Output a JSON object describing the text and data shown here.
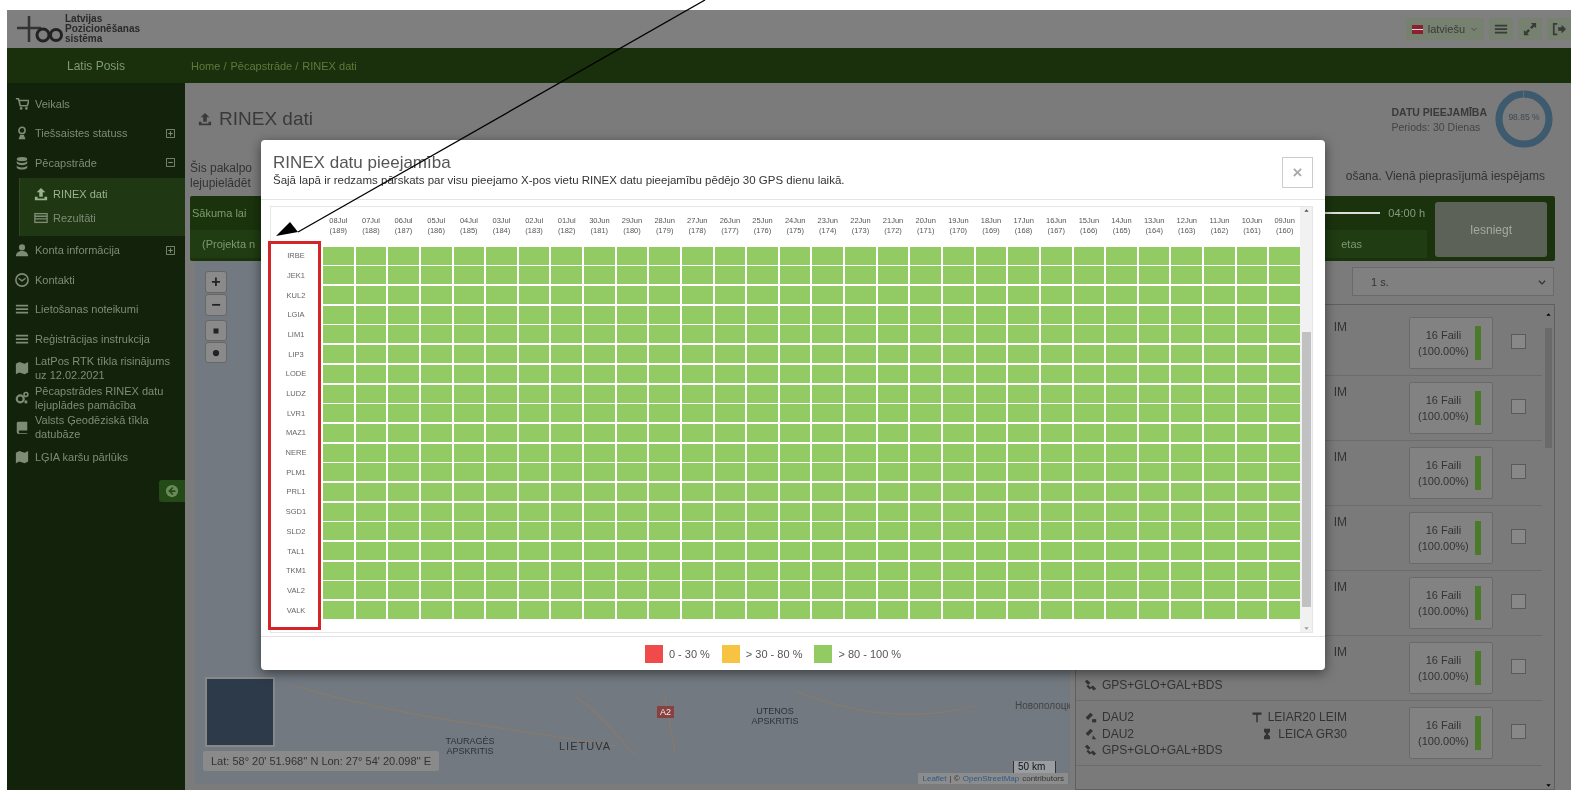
{
  "header": {
    "logo_text": [
      "Latvijas",
      "Pozicionēšanas",
      "sistēma"
    ],
    "language": "latviešu"
  },
  "nav": {
    "user": "Latis Posis",
    "breadcrumbs": [
      "Home /",
      "Pēcapstrāde /",
      "RINEX dati"
    ]
  },
  "sidebar": {
    "items": [
      {
        "label": "Veikals"
      },
      {
        "label": "Tiešsaistes statuss",
        "expanded": false
      },
      {
        "label": "Pēcapstrāde",
        "expanded": true,
        "children": [
          {
            "label": "RINEX dati",
            "selected": true
          },
          {
            "label": "Rezultāti",
            "selected": false
          }
        ]
      },
      {
        "label": "Konta informācija",
        "expanded": false
      },
      {
        "label": "Kontakti"
      },
      {
        "label": "Lietošanas noteikumi"
      },
      {
        "label": "Reģistrācijas instrukcija"
      },
      {
        "label": "LatPos RTK tīkla risinājums uz 12.02.2021"
      },
      {
        "label": "Pēcapstrādes RINEX datu lejuplādes pamācība"
      },
      {
        "label": "Valsts Ģeodēziskā tīkla datubāze"
      },
      {
        "label": "LĢIA karšu pārlūks"
      }
    ]
  },
  "page": {
    "title": "RINEX dati",
    "availability": {
      "label": "DATU PIEEJAMĪBA",
      "period": "Periods: 30 Dienas",
      "value": "98.85 %",
      "level": 0.9885
    },
    "description_left": [
      "Šis pakalpo",
      "lejupielādēt"
    ],
    "description_right": "ošana. Vienā pieprasījumā iespējams",
    "form": {
      "start_label": "Sākuma lai",
      "project_label": "(Projekta n",
      "slider": {
        "level": 1
      },
      "duration": "04:00 h",
      "tail_label": "etas",
      "submit": "Iesniegt"
    },
    "interval": "1 s.",
    "map": {
      "labels": [
        {
          "text": "TAURAGĖS APSKRITIS",
          "kind": "region"
        },
        {
          "text": "LIETUVA",
          "kind": "country"
        },
        {
          "text": "A2",
          "kind": "road"
        },
        {
          "text": "UTENOS APSKRITIS",
          "kind": "region"
        },
        {
          "text": "Новополоцк",
          "kind": "city"
        }
      ],
      "zoom_in": "+",
      "zoom_out": "−",
      "coordinates": "Lat: 58° 20' 51.968'' N Lon: 27° 54' 20.098'' E",
      "scale": "50 km",
      "attribution_link": "Leaflet",
      "attribution_sep": "| ©",
      "attribution_osm": "OpenStreetMap",
      "attribution_tail": "contributors"
    },
    "stations": [
      {
        "antenna": [
          "IM"
        ],
        "files": "16 Faili",
        "percent": "(100.00%)",
        "level": 1,
        "checked": false
      },
      {
        "antenna": [
          "IM"
        ],
        "files": "16 Faili",
        "percent": "(100.00%)",
        "level": 1,
        "checked": false
      },
      {
        "antenna": [
          "IM"
        ],
        "files": "16 Faili",
        "percent": "(100.00%)",
        "level": 1,
        "checked": false
      },
      {
        "antenna": [
          "IM"
        ],
        "files": "16 Faili",
        "percent": "(100.00%)",
        "level": 1,
        "checked": false
      },
      {
        "antenna": [
          "IM"
        ],
        "files": "16 Faili",
        "percent": "(100.00%)",
        "level": 1,
        "checked": false
      },
      {
        "antenna": [
          "IM"
        ],
        "constellation": "GPS+GLO+GAL+BDS",
        "files": "16 Faili",
        "percent": "(100.00%)",
        "level": 1,
        "checked": false
      },
      {
        "receiver": [
          "DAU2",
          "DAU2"
        ],
        "constellation": "GPS+GLO+GAL+BDS",
        "antenna": [
          "LEIAR20 LEIM",
          "LEICA GR30"
        ],
        "files": "16 Faili",
        "percent": "(100.00%)",
        "level": 1,
        "checked": false
      }
    ]
  },
  "modal": {
    "title": "RINEX datu pieejamība",
    "subtitle": "Šajā lapā ir redzams pārskats par visu pieejamo X-pos vietu RINEX datu pieejamību pēdējo 30 GPS dienu laikā.",
    "close": "×",
    "columns": [
      {
        "date": "08Jul",
        "day": "(189)"
      },
      {
        "date": "07Jul",
        "day": "(188)"
      },
      {
        "date": "06Jul",
        "day": "(187)"
      },
      {
        "date": "05Jul",
        "day": "(186)"
      },
      {
        "date": "04Jul",
        "day": "(185)"
      },
      {
        "date": "03Jul",
        "day": "(184)"
      },
      {
        "date": "02Jul",
        "day": "(183)"
      },
      {
        "date": "01Jul",
        "day": "(182)"
      },
      {
        "date": "30Jun",
        "day": "(181)"
      },
      {
        "date": "29Jun",
        "day": "(180)"
      },
      {
        "date": "28Jun",
        "day": "(179)"
      },
      {
        "date": "27Jun",
        "day": "(178)"
      },
      {
        "date": "26Jun",
        "day": "(177)"
      },
      {
        "date": "25Jun",
        "day": "(176)"
      },
      {
        "date": "24Jun",
        "day": "(175)"
      },
      {
        "date": "23Jun",
        "day": "(174)"
      },
      {
        "date": "22Jun",
        "day": "(173)"
      },
      {
        "date": "21Jun",
        "day": "(172)"
      },
      {
        "date": "20Jun",
        "day": "(171)"
      },
      {
        "date": "19Jun",
        "day": "(170)"
      },
      {
        "date": "18Jun",
        "day": "(169)"
      },
      {
        "date": "17Jun",
        "day": "(168)"
      },
      {
        "date": "16Jun",
        "day": "(167)"
      },
      {
        "date": "15Jun",
        "day": "(166)"
      },
      {
        "date": "14Jun",
        "day": "(165)"
      },
      {
        "date": "13Jun",
        "day": "(164)"
      },
      {
        "date": "12Jun",
        "day": "(163)"
      },
      {
        "date": "11Jun",
        "day": "(162)"
      },
      {
        "date": "10Jun",
        "day": "(161)"
      },
      {
        "date": "09Jun",
        "day": "(160)"
      }
    ],
    "rows": [
      {
        "station": "IRBE",
        "cells": [
          {
            "color": "#92cb63"
          },
          {
            "color": "#92cb63"
          },
          {
            "color": "#92cb63"
          },
          {
            "color": "#92cb63"
          },
          {
            "color": "#92cb63"
          },
          {
            "color": "#92cb63"
          },
          {
            "color": "#92cb63"
          },
          {
            "color": "#92cb63"
          },
          {
            "color": "#92cb63"
          },
          {
            "color": "#92cb63"
          },
          {
            "color": "#92cb63"
          },
          {
            "color": "#92cb63"
          },
          {
            "color": "#92cb63"
          },
          {
            "color": "#92cb63"
          },
          {
            "color": "#92cb63"
          },
          {
            "color": "#92cb63"
          },
          {
            "color": "#92cb63"
          },
          {
            "color": "#92cb63"
          },
          {
            "color": "#92cb63"
          },
          {
            "color": "#92cb63"
          },
          {
            "color": "#92cb63"
          },
          {
            "color": "#92cb63"
          },
          {
            "color": "#92cb63"
          },
          {
            "color": "#92cb63"
          },
          {
            "color": "#92cb63"
          },
          {
            "color": "#92cb63"
          },
          {
            "color": "#92cb63"
          },
          {
            "color": "#92cb63"
          },
          {
            "color": "#92cb63"
          },
          {
            "color": "#92cb63"
          }
        ]
      },
      {
        "station": "JEK1",
        "cells": [
          {
            "color": "#92cb63"
          },
          {
            "color": "#92cb63"
          },
          {
            "color": "#92cb63"
          },
          {
            "color": "#92cb63"
          },
          {
            "color": "#92cb63"
          },
          {
            "color": "#92cb63"
          },
          {
            "color": "#92cb63"
          },
          {
            "color": "#92cb63"
          },
          {
            "color": "#92cb63"
          },
          {
            "color": "#92cb63"
          },
          {
            "color": "#92cb63"
          },
          {
            "color": "#92cb63"
          },
          {
            "color": "#92cb63"
          },
          {
            "color": "#92cb63"
          },
          {
            "color": "#92cb63"
          },
          {
            "color": "#92cb63"
          },
          {
            "color": "#92cb63"
          },
          {
            "color": "#92cb63"
          },
          {
            "color": "#92cb63"
          },
          {
            "color": "#92cb63"
          },
          {
            "color": "#92cb63"
          },
          {
            "color": "#92cb63"
          },
          {
            "color": "#92cb63"
          },
          {
            "color": "#92cb63"
          },
          {
            "color": "#92cb63"
          },
          {
            "color": "#92cb63"
          },
          {
            "color": "#92cb63"
          },
          {
            "color": "#92cb63"
          },
          {
            "color": "#92cb63"
          },
          {
            "color": "#92cb63"
          }
        ]
      },
      {
        "station": "KUL2",
        "cells": [
          {
            "color": "#92cb63"
          },
          {
            "color": "#92cb63"
          },
          {
            "color": "#92cb63"
          },
          {
            "color": "#92cb63"
          },
          {
            "color": "#92cb63"
          },
          {
            "color": "#92cb63"
          },
          {
            "color": "#92cb63"
          },
          {
            "color": "#92cb63"
          },
          {
            "color": "#92cb63"
          },
          {
            "color": "#92cb63"
          },
          {
            "color": "#92cb63"
          },
          {
            "color": "#92cb63"
          },
          {
            "color": "#92cb63"
          },
          {
            "color": "#92cb63"
          },
          {
            "color": "#92cb63"
          },
          {
            "color": "#92cb63"
          },
          {
            "color": "#92cb63"
          },
          {
            "color": "#92cb63"
          },
          {
            "color": "#92cb63"
          },
          {
            "color": "#92cb63"
          },
          {
            "color": "#92cb63"
          },
          {
            "color": "#92cb63"
          },
          {
            "color": "#92cb63"
          },
          {
            "color": "#92cb63"
          },
          {
            "color": "#92cb63"
          },
          {
            "color": "#92cb63"
          },
          {
            "color": "#92cb63"
          },
          {
            "color": "#92cb63"
          },
          {
            "color": "#92cb63"
          },
          {
            "color": "#92cb63"
          }
        ]
      },
      {
        "station": "LGIA",
        "cells": [
          {
            "color": "#92cb63"
          },
          {
            "color": "#92cb63"
          },
          {
            "color": "#92cb63"
          },
          {
            "color": "#92cb63"
          },
          {
            "color": "#92cb63"
          },
          {
            "color": "#92cb63"
          },
          {
            "color": "#92cb63"
          },
          {
            "color": "#92cb63"
          },
          {
            "color": "#92cb63"
          },
          {
            "color": "#92cb63"
          },
          {
            "color": "#92cb63"
          },
          {
            "color": "#92cb63"
          },
          {
            "color": "#92cb63"
          },
          {
            "color": "#92cb63"
          },
          {
            "color": "#92cb63"
          },
          {
            "color": "#92cb63"
          },
          {
            "color": "#92cb63"
          },
          {
            "color": "#92cb63"
          },
          {
            "color": "#92cb63"
          },
          {
            "color": "#92cb63"
          },
          {
            "color": "#92cb63"
          },
          {
            "color": "#92cb63"
          },
          {
            "color": "#92cb63"
          },
          {
            "color": "#92cb63"
          },
          {
            "color": "#92cb63"
          },
          {
            "color": "#92cb63"
          },
          {
            "color": "#92cb63"
          },
          {
            "color": "#92cb63"
          },
          {
            "color": "#92cb63"
          },
          {
            "color": "#92cb63"
          }
        ]
      },
      {
        "station": "LIM1",
        "cells": [
          {
            "color": "#92cb63"
          },
          {
            "color": "#92cb63"
          },
          {
            "color": "#92cb63"
          },
          {
            "color": "#92cb63"
          },
          {
            "color": "#92cb63"
          },
          {
            "color": "#92cb63"
          },
          {
            "color": "#92cb63"
          },
          {
            "color": "#92cb63"
          },
          {
            "color": "#92cb63"
          },
          {
            "color": "#92cb63"
          },
          {
            "color": "#92cb63"
          },
          {
            "color": "#92cb63"
          },
          {
            "color": "#92cb63"
          },
          {
            "color": "#92cb63"
          },
          {
            "color": "#92cb63"
          },
          {
            "color": "#92cb63"
          },
          {
            "color": "#92cb63"
          },
          {
            "color": "#92cb63"
          },
          {
            "color": "#92cb63"
          },
          {
            "color": "#92cb63"
          },
          {
            "color": "#92cb63"
          },
          {
            "color": "#92cb63"
          },
          {
            "color": "#92cb63"
          },
          {
            "color": "#92cb63"
          },
          {
            "color": "#92cb63"
          },
          {
            "color": "#92cb63"
          },
          {
            "color": "#92cb63"
          },
          {
            "color": "#92cb63"
          },
          {
            "color": "#92cb63"
          },
          {
            "color": "#92cb63"
          }
        ]
      },
      {
        "station": "LIP3",
        "cells": [
          {
            "color": "#92cb63"
          },
          {
            "color": "#92cb63"
          },
          {
            "color": "#92cb63"
          },
          {
            "color": "#92cb63"
          },
          {
            "color": "#92cb63"
          },
          {
            "color": "#92cb63"
          },
          {
            "color": "#92cb63"
          },
          {
            "color": "#92cb63"
          },
          {
            "color": "#92cb63"
          },
          {
            "color": "#92cb63"
          },
          {
            "color": "#92cb63"
          },
          {
            "color": "#92cb63"
          },
          {
            "color": "#92cb63"
          },
          {
            "color": "#92cb63"
          },
          {
            "color": "#92cb63"
          },
          {
            "color": "#92cb63"
          },
          {
            "color": "#92cb63"
          },
          {
            "color": "#92cb63"
          },
          {
            "color": "#92cb63"
          },
          {
            "color": "#92cb63"
          },
          {
            "color": "#92cb63"
          },
          {
            "color": "#92cb63"
          },
          {
            "color": "#92cb63"
          },
          {
            "color": "#92cb63"
          },
          {
            "color": "#92cb63"
          },
          {
            "color": "#92cb63"
          },
          {
            "color": "#92cb63"
          },
          {
            "color": "#92cb63"
          },
          {
            "color": "#92cb63"
          },
          {
            "color": "#92cb63"
          }
        ]
      },
      {
        "station": "LODE",
        "cells": [
          {
            "color": "#92cb63"
          },
          {
            "color": "#92cb63"
          },
          {
            "color": "#92cb63"
          },
          {
            "color": "#92cb63"
          },
          {
            "color": "#92cb63"
          },
          {
            "color": "#92cb63"
          },
          {
            "color": "#92cb63"
          },
          {
            "color": "#92cb63"
          },
          {
            "color": "#92cb63"
          },
          {
            "color": "#92cb63"
          },
          {
            "color": "#92cb63"
          },
          {
            "color": "#92cb63"
          },
          {
            "color": "#92cb63"
          },
          {
            "color": "#92cb63"
          },
          {
            "color": "#92cb63"
          },
          {
            "color": "#92cb63"
          },
          {
            "color": "#92cb63"
          },
          {
            "color": "#92cb63"
          },
          {
            "color": "#92cb63"
          },
          {
            "color": "#92cb63"
          },
          {
            "color": "#92cb63"
          },
          {
            "color": "#92cb63"
          },
          {
            "color": "#92cb63"
          },
          {
            "color": "#92cb63"
          },
          {
            "color": "#92cb63"
          },
          {
            "color": "#92cb63"
          },
          {
            "color": "#92cb63"
          },
          {
            "color": "#92cb63"
          },
          {
            "color": "#92cb63"
          },
          {
            "color": "#92cb63"
          }
        ]
      },
      {
        "station": "LUDZ",
        "cells": [
          {
            "color": "#92cb63"
          },
          {
            "color": "#92cb63"
          },
          {
            "color": "#92cb63"
          },
          {
            "color": "#92cb63"
          },
          {
            "color": "#92cb63"
          },
          {
            "color": "#92cb63"
          },
          {
            "color": "#92cb63"
          },
          {
            "color": "#92cb63"
          },
          {
            "color": "#92cb63"
          },
          {
            "color": "#92cb63"
          },
          {
            "color": "#92cb63"
          },
          {
            "color": "#92cb63"
          },
          {
            "color": "#92cb63"
          },
          {
            "color": "#92cb63"
          },
          {
            "color": "#92cb63"
          },
          {
            "color": "#92cb63"
          },
          {
            "color": "#92cb63"
          },
          {
            "color": "#92cb63"
          },
          {
            "color": "#92cb63"
          },
          {
            "color": "#92cb63"
          },
          {
            "color": "#92cb63"
          },
          {
            "color": "#92cb63"
          },
          {
            "color": "#92cb63"
          },
          {
            "color": "#92cb63"
          },
          {
            "color": "#92cb63"
          },
          {
            "color": "#92cb63"
          },
          {
            "color": "#92cb63"
          },
          {
            "color": "#92cb63"
          },
          {
            "color": "#92cb63"
          },
          {
            "color": "#92cb63"
          }
        ]
      },
      {
        "station": "LVR1",
        "cells": [
          {
            "color": "#92cb63"
          },
          {
            "color": "#92cb63"
          },
          {
            "color": "#92cb63"
          },
          {
            "color": "#92cb63"
          },
          {
            "color": "#92cb63"
          },
          {
            "color": "#92cb63"
          },
          {
            "color": "#92cb63"
          },
          {
            "color": "#92cb63"
          },
          {
            "color": "#92cb63"
          },
          {
            "color": "#92cb63"
          },
          {
            "color": "#92cb63"
          },
          {
            "color": "#92cb63"
          },
          {
            "color": "#92cb63"
          },
          {
            "color": "#92cb63"
          },
          {
            "color": "#92cb63"
          },
          {
            "color": "#92cb63"
          },
          {
            "color": "#92cb63"
          },
          {
            "color": "#92cb63"
          },
          {
            "color": "#92cb63"
          },
          {
            "color": "#92cb63"
          },
          {
            "color": "#92cb63"
          },
          {
            "color": "#92cb63"
          },
          {
            "color": "#92cb63"
          },
          {
            "color": "#92cb63"
          },
          {
            "color": "#92cb63"
          },
          {
            "color": "#92cb63"
          },
          {
            "color": "#92cb63"
          },
          {
            "color": "#92cb63"
          },
          {
            "color": "#92cb63"
          },
          {
            "color": "#92cb63"
          }
        ]
      },
      {
        "station": "MAZ1",
        "cells": [
          {
            "color": "#92cb63"
          },
          {
            "color": "#92cb63"
          },
          {
            "color": "#92cb63"
          },
          {
            "color": "#92cb63"
          },
          {
            "color": "#92cb63"
          },
          {
            "color": "#92cb63"
          },
          {
            "color": "#92cb63"
          },
          {
            "color": "#92cb63"
          },
          {
            "color": "#92cb63"
          },
          {
            "color": "#92cb63"
          },
          {
            "color": "#92cb63"
          },
          {
            "color": "#92cb63"
          },
          {
            "color": "#92cb63"
          },
          {
            "color": "#92cb63"
          },
          {
            "color": "#92cb63"
          },
          {
            "color": "#92cb63"
          },
          {
            "color": "#92cb63"
          },
          {
            "color": "#92cb63"
          },
          {
            "color": "#92cb63"
          },
          {
            "color": "#92cb63"
          },
          {
            "color": "#92cb63"
          },
          {
            "color": "#92cb63"
          },
          {
            "color": "#92cb63"
          },
          {
            "color": "#92cb63"
          },
          {
            "color": "#92cb63"
          },
          {
            "color": "#92cb63"
          },
          {
            "color": "#92cb63"
          },
          {
            "color": "#92cb63"
          },
          {
            "color": "#92cb63"
          },
          {
            "color": "#92cb63"
          }
        ]
      },
      {
        "station": "NERE",
        "cells": [
          {
            "color": "#92cb63"
          },
          {
            "color": "#92cb63"
          },
          {
            "color": "#92cb63"
          },
          {
            "color": "#92cb63"
          },
          {
            "color": "#92cb63"
          },
          {
            "color": "#92cb63"
          },
          {
            "color": "#92cb63"
          },
          {
            "color": "#92cb63"
          },
          {
            "color": "#92cb63"
          },
          {
            "color": "#92cb63"
          },
          {
            "color": "#92cb63"
          },
          {
            "color": "#92cb63"
          },
          {
            "color": "#92cb63"
          },
          {
            "color": "#92cb63"
          },
          {
            "color": "#92cb63"
          },
          {
            "color": "#92cb63"
          },
          {
            "color": "#92cb63"
          },
          {
            "color": "#92cb63"
          },
          {
            "color": "#92cb63"
          },
          {
            "color": "#92cb63"
          },
          {
            "color": "#92cb63"
          },
          {
            "color": "#92cb63"
          },
          {
            "color": "#92cb63"
          },
          {
            "color": "#92cb63"
          },
          {
            "color": "#92cb63"
          },
          {
            "color": "#92cb63"
          },
          {
            "color": "#92cb63"
          },
          {
            "color": "#92cb63"
          },
          {
            "color": "#92cb63"
          },
          {
            "color": "#92cb63"
          }
        ]
      },
      {
        "station": "PLM1",
        "cells": [
          {
            "color": "#92cb63"
          },
          {
            "color": "#92cb63"
          },
          {
            "color": "#92cb63"
          },
          {
            "color": "#92cb63"
          },
          {
            "color": "#92cb63"
          },
          {
            "color": "#92cb63"
          },
          {
            "color": "#92cb63"
          },
          {
            "color": "#92cb63"
          },
          {
            "color": "#92cb63"
          },
          {
            "color": "#92cb63"
          },
          {
            "color": "#92cb63"
          },
          {
            "color": "#92cb63"
          },
          {
            "color": "#92cb63"
          },
          {
            "color": "#92cb63"
          },
          {
            "color": "#92cb63"
          },
          {
            "color": "#92cb63"
          },
          {
            "color": "#92cb63"
          },
          {
            "color": "#92cb63"
          },
          {
            "color": "#92cb63"
          },
          {
            "color": "#92cb63"
          },
          {
            "color": "#92cb63"
          },
          {
            "color": "#92cb63"
          },
          {
            "color": "#92cb63"
          },
          {
            "color": "#92cb63"
          },
          {
            "color": "#92cb63"
          },
          {
            "color": "#92cb63"
          },
          {
            "color": "#92cb63"
          },
          {
            "color": "#92cb63"
          },
          {
            "color": "#92cb63"
          },
          {
            "color": "#92cb63"
          }
        ]
      },
      {
        "station": "PRL1",
        "cells": [
          {
            "color": "#92cb63"
          },
          {
            "color": "#92cb63"
          },
          {
            "color": "#92cb63"
          },
          {
            "color": "#92cb63"
          },
          {
            "color": "#92cb63"
          },
          {
            "color": "#92cb63"
          },
          {
            "color": "#92cb63"
          },
          {
            "color": "#92cb63"
          },
          {
            "color": "#92cb63"
          },
          {
            "color": "#92cb63"
          },
          {
            "color": "#92cb63"
          },
          {
            "color": "#92cb63"
          },
          {
            "color": "#92cb63"
          },
          {
            "color": "#92cb63"
          },
          {
            "color": "#92cb63"
          },
          {
            "color": "#92cb63"
          },
          {
            "color": "#92cb63"
          },
          {
            "color": "#92cb63"
          },
          {
            "color": "#92cb63"
          },
          {
            "color": "#92cb63"
          },
          {
            "color": "#92cb63"
          },
          {
            "color": "#92cb63"
          },
          {
            "color": "#92cb63"
          },
          {
            "color": "#92cb63"
          },
          {
            "color": "#92cb63"
          },
          {
            "color": "#92cb63"
          },
          {
            "color": "#92cb63"
          },
          {
            "color": "#92cb63"
          },
          {
            "color": "#92cb63"
          },
          {
            "color": "#92cb63"
          }
        ]
      },
      {
        "station": "SGD1",
        "cells": [
          {
            "color": "#92cb63"
          },
          {
            "color": "#92cb63"
          },
          {
            "color": "#92cb63"
          },
          {
            "color": "#92cb63"
          },
          {
            "color": "#92cb63"
          },
          {
            "color": "#92cb63"
          },
          {
            "color": "#92cb63"
          },
          {
            "color": "#92cb63"
          },
          {
            "color": "#92cb63"
          },
          {
            "color": "#92cb63"
          },
          {
            "color": "#92cb63"
          },
          {
            "color": "#92cb63"
          },
          {
            "color": "#92cb63"
          },
          {
            "color": "#92cb63"
          },
          {
            "color": "#92cb63"
          },
          {
            "color": "#92cb63"
          },
          {
            "color": "#92cb63"
          },
          {
            "color": "#92cb63"
          },
          {
            "color": "#92cb63"
          },
          {
            "color": "#92cb63"
          },
          {
            "color": "#92cb63"
          },
          {
            "color": "#92cb63"
          },
          {
            "color": "#92cb63"
          },
          {
            "color": "#92cb63"
          },
          {
            "color": "#92cb63"
          },
          {
            "color": "#92cb63"
          },
          {
            "color": "#92cb63"
          },
          {
            "color": "#92cb63"
          },
          {
            "color": "#92cb63"
          },
          {
            "color": "#92cb63"
          }
        ]
      },
      {
        "station": "SLD2",
        "cells": [
          {
            "color": "#92cb63"
          },
          {
            "color": "#92cb63"
          },
          {
            "color": "#92cb63"
          },
          {
            "color": "#92cb63"
          },
          {
            "color": "#92cb63"
          },
          {
            "color": "#92cb63"
          },
          {
            "color": "#92cb63"
          },
          {
            "color": "#92cb63"
          },
          {
            "color": "#92cb63"
          },
          {
            "color": "#92cb63"
          },
          {
            "color": "#92cb63"
          },
          {
            "color": "#92cb63"
          },
          {
            "color": "#92cb63"
          },
          {
            "color": "#92cb63"
          },
          {
            "color": "#92cb63"
          },
          {
            "color": "#92cb63"
          },
          {
            "color": "#92cb63"
          },
          {
            "color": "#92cb63"
          },
          {
            "color": "#92cb63"
          },
          {
            "color": "#92cb63"
          },
          {
            "color": "#92cb63"
          },
          {
            "color": "#92cb63"
          },
          {
            "color": "#92cb63"
          },
          {
            "color": "#92cb63"
          },
          {
            "color": "#92cb63"
          },
          {
            "color": "#92cb63"
          },
          {
            "color": "#92cb63"
          },
          {
            "color": "#92cb63"
          },
          {
            "color": "#92cb63"
          },
          {
            "color": "#92cb63"
          }
        ]
      },
      {
        "station": "TAL1",
        "cells": [
          {
            "color": "#92cb63"
          },
          {
            "color": "#92cb63"
          },
          {
            "color": "#92cb63"
          },
          {
            "color": "#92cb63"
          },
          {
            "color": "#92cb63"
          },
          {
            "color": "#92cb63"
          },
          {
            "color": "#92cb63"
          },
          {
            "color": "#92cb63"
          },
          {
            "color": "#92cb63"
          },
          {
            "color": "#92cb63"
          },
          {
            "color": "#92cb63"
          },
          {
            "color": "#92cb63"
          },
          {
            "color": "#92cb63"
          },
          {
            "color": "#92cb63"
          },
          {
            "color": "#92cb63"
          },
          {
            "color": "#92cb63"
          },
          {
            "color": "#92cb63"
          },
          {
            "color": "#92cb63"
          },
          {
            "color": "#92cb63"
          },
          {
            "color": "#92cb63"
          },
          {
            "color": "#92cb63"
          },
          {
            "color": "#92cb63"
          },
          {
            "color": "#92cb63"
          },
          {
            "color": "#92cb63"
          },
          {
            "color": "#92cb63"
          },
          {
            "color": "#92cb63"
          },
          {
            "color": "#92cb63"
          },
          {
            "color": "#92cb63"
          },
          {
            "color": "#92cb63"
          },
          {
            "color": "#92cb63"
          }
        ]
      },
      {
        "station": "TKM1",
        "cells": [
          {
            "color": "#92cb63"
          },
          {
            "color": "#92cb63"
          },
          {
            "color": "#92cb63"
          },
          {
            "color": "#92cb63"
          },
          {
            "color": "#92cb63"
          },
          {
            "color": "#92cb63"
          },
          {
            "color": "#92cb63"
          },
          {
            "color": "#92cb63"
          },
          {
            "color": "#92cb63"
          },
          {
            "color": "#92cb63"
          },
          {
            "color": "#92cb63"
          },
          {
            "color": "#92cb63"
          },
          {
            "color": "#92cb63"
          },
          {
            "color": "#92cb63"
          },
          {
            "color": "#92cb63"
          },
          {
            "color": "#92cb63"
          },
          {
            "color": "#92cb63"
          },
          {
            "color": "#92cb63"
          },
          {
            "color": "#92cb63"
          },
          {
            "color": "#92cb63"
          },
          {
            "color": "#92cb63"
          },
          {
            "color": "#92cb63"
          },
          {
            "color": "#92cb63"
          },
          {
            "color": "#92cb63"
          },
          {
            "color": "#92cb63"
          },
          {
            "color": "#92cb63"
          },
          {
            "color": "#92cb63"
          },
          {
            "color": "#92cb63"
          },
          {
            "color": "#92cb63"
          },
          {
            "color": "#92cb63"
          }
        ]
      },
      {
        "station": "VAL2",
        "cells": [
          {
            "color": "#92cb63"
          },
          {
            "color": "#92cb63"
          },
          {
            "color": "#92cb63"
          },
          {
            "color": "#92cb63"
          },
          {
            "color": "#92cb63"
          },
          {
            "color": "#92cb63"
          },
          {
            "color": "#92cb63"
          },
          {
            "color": "#92cb63"
          },
          {
            "color": "#92cb63"
          },
          {
            "color": "#92cb63"
          },
          {
            "color": "#92cb63"
          },
          {
            "color": "#92cb63"
          },
          {
            "color": "#92cb63"
          },
          {
            "color": "#92cb63"
          },
          {
            "color": "#92cb63"
          },
          {
            "color": "#92cb63"
          },
          {
            "color": "#92cb63"
          },
          {
            "color": "#92cb63"
          },
          {
            "color": "#92cb63"
          },
          {
            "color": "#92cb63"
          },
          {
            "color": "#92cb63"
          },
          {
            "color": "#92cb63"
          },
          {
            "color": "#92cb63"
          },
          {
            "color": "#92cb63"
          },
          {
            "color": "#92cb63"
          },
          {
            "color": "#92cb63"
          },
          {
            "color": "#92cb63"
          },
          {
            "color": "#92cb63"
          },
          {
            "color": "#92cb63"
          },
          {
            "color": "#92cb63"
          }
        ]
      },
      {
        "station": "VALK",
        "cells": [
          {
            "color": "#92cb63"
          },
          {
            "color": "#92cb63"
          },
          {
            "color": "#92cb63"
          },
          {
            "color": "#92cb63"
          },
          {
            "color": "#92cb63"
          },
          {
            "color": "#92cb63"
          },
          {
            "color": "#92cb63"
          },
          {
            "color": "#92cb63"
          },
          {
            "color": "#92cb63"
          },
          {
            "color": "#92cb63"
          },
          {
            "color": "#92cb63"
          },
          {
            "color": "#92cb63"
          },
          {
            "color": "#92cb63"
          },
          {
            "color": "#92cb63"
          },
          {
            "color": "#92cb63"
          },
          {
            "color": "#92cb63"
          },
          {
            "color": "#92cb63"
          },
          {
            "color": "#92cb63"
          },
          {
            "color": "#92cb63"
          },
          {
            "color": "#92cb63"
          },
          {
            "color": "#92cb63"
          },
          {
            "color": "#92cb63"
          },
          {
            "color": "#92cb63"
          },
          {
            "color": "#92cb63"
          },
          {
            "color": "#92cb63"
          },
          {
            "color": "#92cb63"
          },
          {
            "color": "#92cb63"
          },
          {
            "color": "#92cb63"
          },
          {
            "color": "#92cb63"
          },
          {
            "color": "#92cb63"
          }
        ]
      }
    ],
    "legend": [
      {
        "label": "0 - 30 %",
        "color": "#f04a4a"
      },
      {
        "label": "> 30 - 80 %",
        "color": "#f6c343"
      },
      {
        "label": "> 80 - 100 %",
        "color": "#92cb63"
      }
    ]
  }
}
